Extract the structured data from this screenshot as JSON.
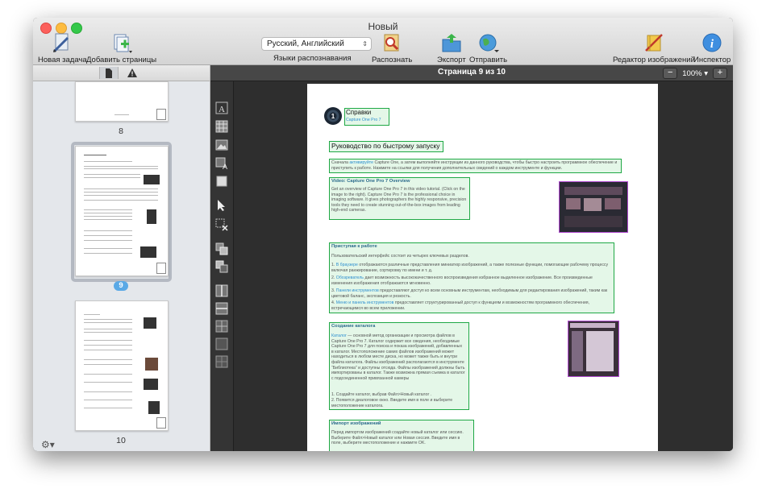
{
  "window": {
    "title": "Новый"
  },
  "toolbar": {
    "new_task": "Новая задача",
    "add_pages": "Добавить страницы",
    "languages_value": "Русский, Английский",
    "languages_label": "Языки распознавания",
    "recognize": "Распознать",
    "export": "Экспорт",
    "send": "Отправить",
    "image_editor": "Редактор изображений",
    "inspector": "Инспектор"
  },
  "sidebar": {
    "pages": [
      {
        "number": "8",
        "selected": false
      },
      {
        "number": "9",
        "selected": true
      },
      {
        "number": "10",
        "selected": false
      }
    ]
  },
  "main": {
    "page_indicator": "Страница 9 из 10",
    "zoom": "100%",
    "zoom_minus": "−",
    "zoom_plus": "+"
  },
  "document": {
    "logo_title": "Справки",
    "logo_subtitle": "Capture One Pro 7",
    "heading": "Руководство по быстрому запуску",
    "intro_pre": "Сначала ",
    "intro_link": "активируйте",
    "intro_post": " Capture One, а затем выполняйте инструкции из данного руководства, чтобы быстро настроить программное обеспечение и приступить к работе. Нажмите на ссылки для получения дополнительных сведений о каждом инструменте и функции.",
    "video_heading": "Video: Capture One Pro 7 Overview",
    "video_text": "Get an overview of Capture One Pro 7 in this video tutorial. (Click on the image to the right). Capture One Pro 7 is the professional choice in imaging software. It gives photographers the highly responsive, precision tools they need to create stunning out-of-the-box images from leading high-end cameras.",
    "start_heading": "Приступая к работе",
    "start_intro": "Пользовательский интерфейс состоит из четырех ключевых разделов.",
    "start_items": [
      {
        "num": "1.",
        "link": "В браузере",
        "text": " отображаются различные представления миниатюр изображений, а также полезные функции, помогающие рабочему процессу включая ранжирование, сортировку по имени и т. д."
      },
      {
        "num": "2.",
        "link": "Обозреватель",
        "text": " дает возможность высококачественного воспроизведения избранное выделенное изображение. Все произведенные изменения изображения отображаются мгновенно."
      },
      {
        "num": "3.",
        "link": "Панели инструментов",
        "text": " предоставляют доступ ко всем основным инструментам, необходимым для редактирования изображений, таким как цветовой баланс, экспозиция и резкость."
      },
      {
        "num": "4.",
        "link": "Меню и  панель инструментов",
        "text": " предоставляет структурированный доступ к функциям и возможностям программного обеспечения, встречающимся во всем приложении."
      }
    ],
    "catalog_heading": "Создание каталога",
    "catalog_link": "Каталог",
    "catalog_text": " — основной метод организации и просмотра файлов в Capture One Pro 7. Каталог содержит все сведения, необходимые Capture One Pro 7 для поиска и показа изображений, добавленных в каталог. Местоположение самих файлов изображений может находиться в любом месте диска, но может также быть и внутри файла каталога. Файлы изображений располагаются в инструменте “Библиотека” и доступны отсюда. Файлы изображений должны быть импортированы в каталог. Также возможна прямая съемка в каталог с подсоединенной привязанной камеры",
    "catalog_items": [
      {
        "num": "1.",
        "text": "Создайте каталог, выбрав Файл>Новый каталог ."
      },
      {
        "num": "2.",
        "text": "Появится диалоговое окно. Введите имя в поле и выберите местоположение каталога."
      }
    ],
    "import_heading": "Импорт изображений",
    "import_text": "Перед импортом изображений создайте новый каталог или сессию. Выберите Файл>Новый каталог или Новая сессия. Введите имя в поле, выберите местоположение и нажмите OK."
  },
  "colors": {
    "zone_green": "#1fa845",
    "zone_purple": "#b14bd1",
    "selection_blue": "#5aa9e6"
  },
  "icons": [
    "new-task-icon",
    "add-pages-icon",
    "recognize-icon",
    "export-icon",
    "send-icon",
    "image-editor-icon",
    "inspector-icon",
    "pages-icon",
    "warning-icon",
    "gear-icon"
  ]
}
